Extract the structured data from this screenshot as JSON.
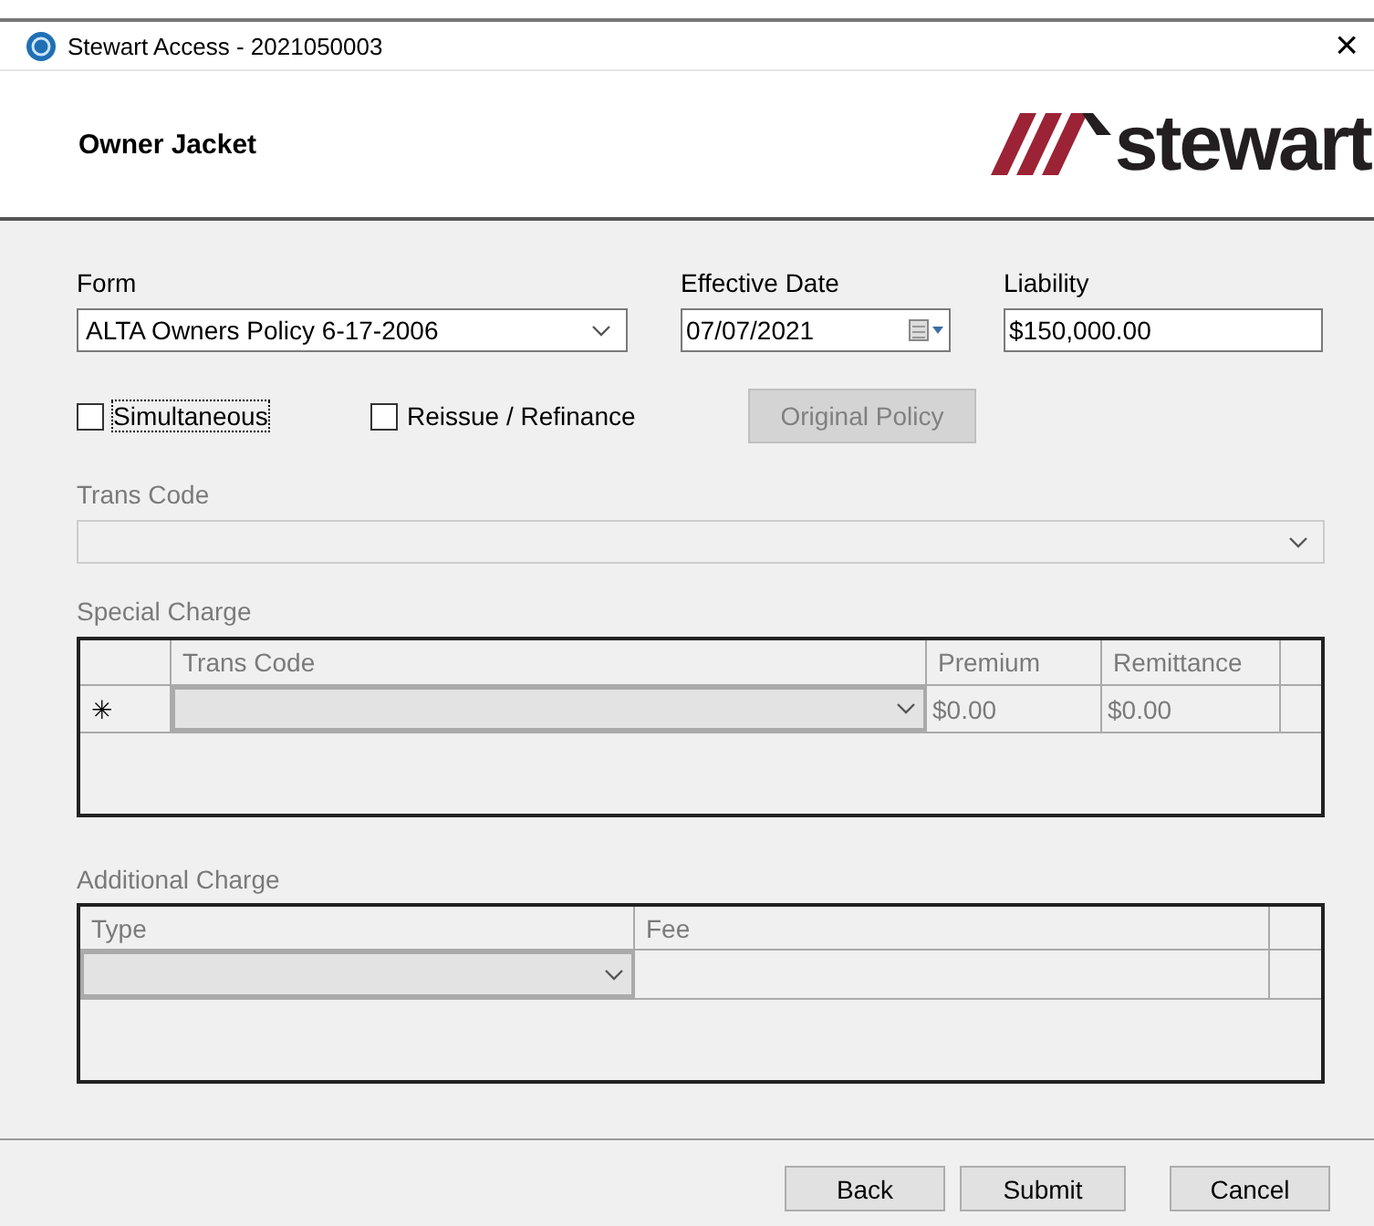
{
  "window": {
    "title": "Stewart Access - 2021050003",
    "close": "×"
  },
  "header": {
    "title": "Owner Jacket",
    "logo_text": "stewart"
  },
  "form": {
    "label": "Form",
    "value": "ALTA Owners Policy 6-17-2006"
  },
  "effective_date": {
    "label": "Effective Date",
    "value": "07/07/2021"
  },
  "liability": {
    "label": "Liability",
    "value": "$150,000.00"
  },
  "checkboxes": [
    {
      "label": "Simultaneous",
      "checked": false,
      "focused": true
    },
    {
      "label": "Reissue / Refinance",
      "checked": false,
      "focused": false
    }
  ],
  "original_policy_button": {
    "label": "Original Policy",
    "disabled": true
  },
  "trans_code": {
    "label": "Trans Code",
    "disabled": true
  },
  "special_charge": {
    "label": "Special Charge",
    "columns": [
      "Trans Code",
      "Premium",
      "Remittance"
    ],
    "rows": [
      {
        "marker": "✳",
        "premium": "$0.00",
        "remittance": "$0.00"
      }
    ]
  },
  "additional_charge": {
    "label": "Additional Charge",
    "columns": [
      "Type",
      "Fee"
    ]
  },
  "buttons": [
    "Back",
    "Submit",
    "Cancel"
  ]
}
